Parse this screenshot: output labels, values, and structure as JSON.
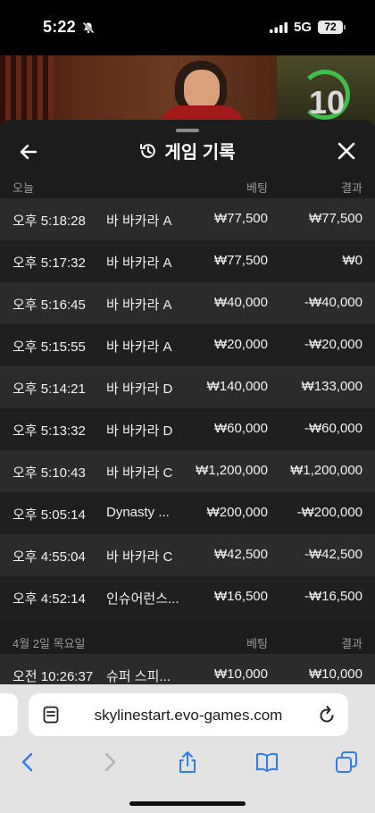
{
  "status_bar": {
    "time": "5:22",
    "network": "5G",
    "battery": "72"
  },
  "video": {
    "countdown": "10"
  },
  "sheet": {
    "title": "게임 기록",
    "today_section": {
      "label": "오늘",
      "bet_header": "베팅",
      "result_header": "결과"
    },
    "today_rows": [
      {
        "time": "오후 5:18:28",
        "game": "바 바카라 A",
        "bet": "₩77,500",
        "result": "₩77,500"
      },
      {
        "time": "오후 5:17:32",
        "game": "바 바카라 A",
        "bet": "₩77,500",
        "result": "₩0"
      },
      {
        "time": "오후 5:16:45",
        "game": "바 바카라 A",
        "bet": "₩40,000",
        "result": "-₩40,000"
      },
      {
        "time": "오후 5:15:55",
        "game": "바 바카라 A",
        "bet": "₩20,000",
        "result": "-₩20,000"
      },
      {
        "time": "오후 5:14:21",
        "game": "바 바카라 D",
        "bet": "₩140,000",
        "result": "₩133,000"
      },
      {
        "time": "오후 5:13:32",
        "game": "바 바카라 D",
        "bet": "₩60,000",
        "result": "-₩60,000"
      },
      {
        "time": "오후 5:10:43",
        "game": "바 바카라 C",
        "bet": "₩1,200,000",
        "result": "₩1,200,000"
      },
      {
        "time": "오후 5:05:14",
        "game": "Dynasty ...",
        "bet": "₩200,000",
        "result": "-₩200,000"
      },
      {
        "time": "오후 4:55:04",
        "game": "바 바카라 C",
        "bet": "₩42,500",
        "result": "-₩42,500"
      },
      {
        "time": "오후 4:52:14",
        "game": "인슈어런스...",
        "bet": "₩16,500",
        "result": "-₩16,500"
      }
    ],
    "prev_section": {
      "label": "4월 2일 목요일",
      "bet_header": "베팅",
      "result_header": "결과"
    },
    "prev_rows": [
      {
        "time": "오전 10:26:37",
        "game": "슈퍼 스피...",
        "bet": "₩10,000",
        "result": "₩10,000"
      }
    ]
  },
  "browser": {
    "url": "skylinestart.evo-games.com"
  },
  "colors": {
    "sheet_bg": "#1c1c1c",
    "row_alt": "#2b2b2b",
    "timer_green": "#3fbf4a",
    "ios_blue": "#2f7cf6"
  }
}
